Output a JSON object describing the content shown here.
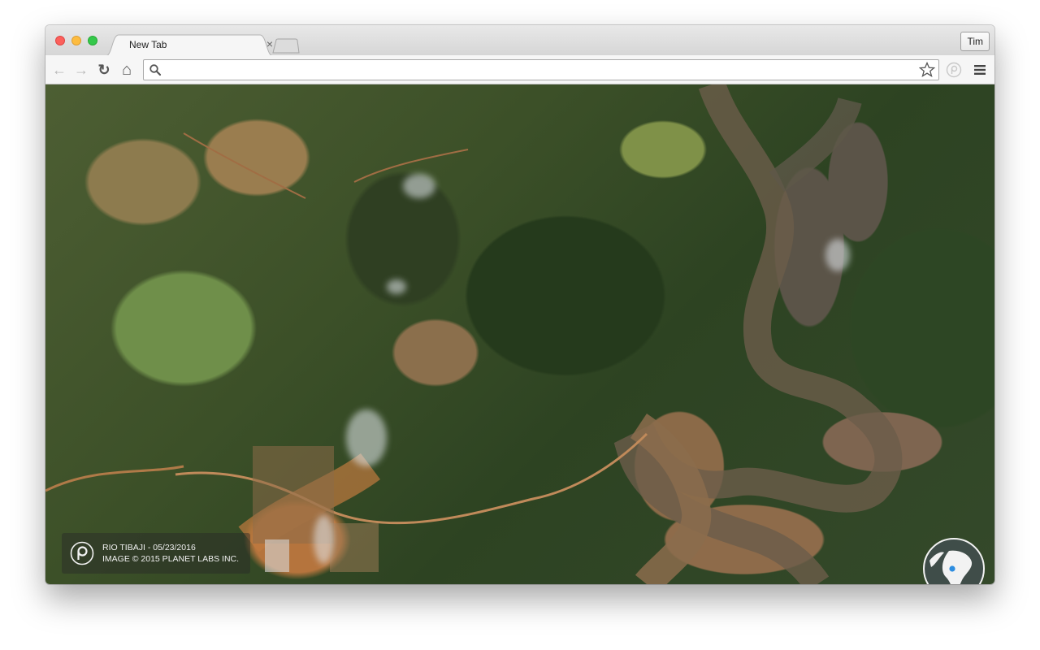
{
  "browser": {
    "tab": {
      "title": "New Tab",
      "close": "×"
    },
    "profile": {
      "name": "Tim"
    },
    "omnibox": {
      "value": "",
      "placeholder": ""
    },
    "nav": {
      "back": "←",
      "forward": "→",
      "reload": "↻",
      "home": "⌂"
    }
  },
  "content": {
    "caption": {
      "location": "RIO TIBAJI - 05/23/2016",
      "credit": "IMAGE © 2015 PLANET LABS INC."
    }
  },
  "colors": {
    "close": "#fc605c",
    "minimize": "#fdbc40",
    "maximize": "#34c84a"
  },
  "icons": [
    "search-icon",
    "star-icon",
    "planet-extension-icon",
    "menu-icon",
    "planet-logo-icon",
    "globe-icon"
  ]
}
